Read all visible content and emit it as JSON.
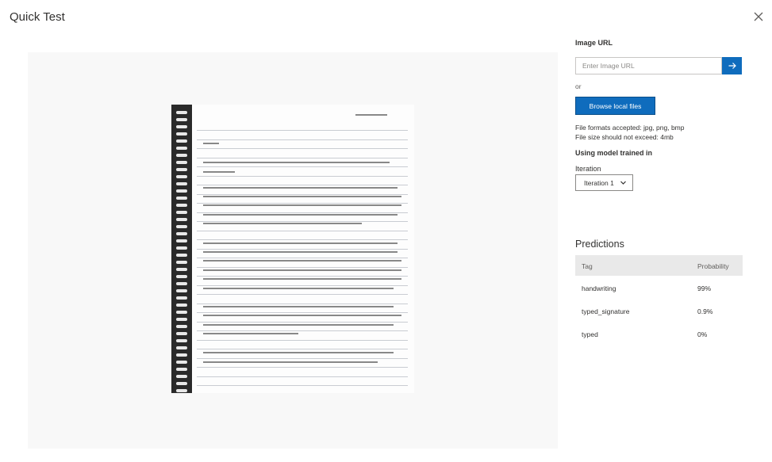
{
  "dialog": {
    "title": "Quick Test"
  },
  "image_url": {
    "label": "Image URL",
    "placeholder": "Enter Image URL"
  },
  "or_text": "or",
  "browse": {
    "label": "Browse local files"
  },
  "file_info": {
    "formats": "File formats accepted: jpg, png, bmp",
    "size": "File size should not exceed: 4mb"
  },
  "model": {
    "label": "Using model trained in",
    "iteration_label": "Iteration",
    "iteration_value": "Iteration 1"
  },
  "predictions": {
    "title": "Predictions",
    "headers": {
      "tag": "Tag",
      "probability": "Probability"
    },
    "rows": [
      {
        "tag": "handwriting",
        "probability": "99%"
      },
      {
        "tag": "typed_signature",
        "probability": "0.9%"
      },
      {
        "tag": "typed",
        "probability": "0%"
      }
    ]
  },
  "colors": {
    "accent": "#0f6cbd",
    "table_header_bg": "#e9e9e9"
  },
  "icons": {
    "close": "close-icon",
    "arrow": "arrow-right-icon",
    "chevron": "chevron-down-icon"
  }
}
